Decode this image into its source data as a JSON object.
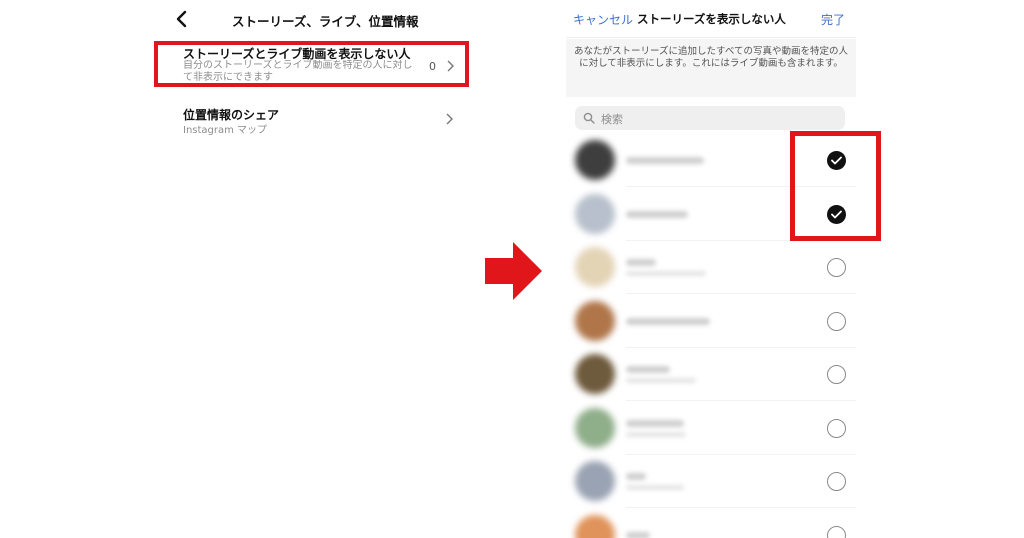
{
  "left": {
    "title": "ストーリーズ、ライブ、位置情報",
    "row1": {
      "label": "ストーリーズとライブ動画を表示しない人",
      "sub": "自分のストーリーズとライブ動画を特定の人に対して非表示にできます",
      "count": "0"
    },
    "row2": {
      "label": "位置情報のシェア",
      "sub": "Instagram マップ"
    }
  },
  "right": {
    "cancel": "キャンセル",
    "title": "ストーリーズを表示しない人",
    "done": "完了",
    "description": "あなたがストーリーズに追加したすべての写真や動画を特定の人に対して非表示にします。これにはライブ動画も含まれます。",
    "search_placeholder": "検索",
    "users": [
      {
        "checked": true,
        "avatar_color": "#3e3e3e"
      },
      {
        "checked": true,
        "avatar_color": "#b7c0cc"
      },
      {
        "checked": false,
        "avatar_color": "#e3d4b6"
      },
      {
        "checked": false,
        "avatar_color": "#b0764a"
      },
      {
        "checked": false,
        "avatar_color": "#6e5a3c"
      },
      {
        "checked": false,
        "avatar_color": "#8fae8a"
      },
      {
        "checked": false,
        "avatar_color": "#9aa3b3"
      },
      {
        "checked": false,
        "avatar_color": "#e0935a"
      }
    ]
  },
  "colors": {
    "accent_blue": "#3f6fcf",
    "highlight_red": "#e0161b"
  }
}
